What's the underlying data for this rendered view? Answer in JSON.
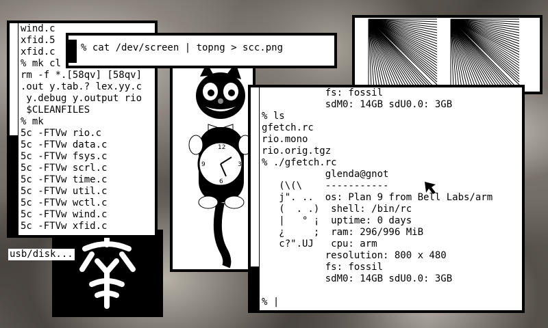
{
  "terminal_left": {
    "lines": [
      "wind.c",
      "xfid.5",
      "xfid.c",
      "% mk cl",
      "rm -f *.[58qv] [58qv]",
      ".out y.tab.? lex.yy.c",
      " y.debug y.output rio",
      " $CLEANFILES",
      "% mk",
      "5c -FTVw rio.c",
      "5c -FTVw data.c",
      "5c -FTVw fsys.c",
      "5c -FTVw scrl.c",
      "5c -FTVw time.c",
      "5c -FTVw util.c",
      "5c -FTVw wctl.c",
      "5c -FTVw wind.c",
      "5c -FTVw xfid.c"
    ]
  },
  "command_window": {
    "command": "% cat /dev/screen | topng > scc.png"
  },
  "usb_label": "usb/disk...",
  "fetch_window": {
    "lines": [
      "           fs: fossil",
      "           sdM0: 14GB sdU0.0: 3GB",
      "% ls",
      "gfetch.rc",
      "rio.mono",
      "rio.orig.tgz",
      "% ./gfetch.rc",
      "           glenda@gnot",
      "   (\\(\\    -----------",
      "   j\". ..  os: Plan 9 from Bell Labs/arm",
      "   (  . .)  shell: /bin/rc",
      "   |   ° ¡  uptime: 0 days",
      "   ¿     ;  ram: 296/996 MiB",
      "   c?\".UJ   cpu: arm",
      "           resolution: 800 x 480",
      "           fs: fossil",
      "           sdM0: 14GB sdU0.0: 3GB"
    ],
    "prompt": "% "
  },
  "icons": {
    "logo": "glenda-kanji-logo",
    "clock": "kit-cat-clock",
    "cursor": "arrow-cursor"
  }
}
